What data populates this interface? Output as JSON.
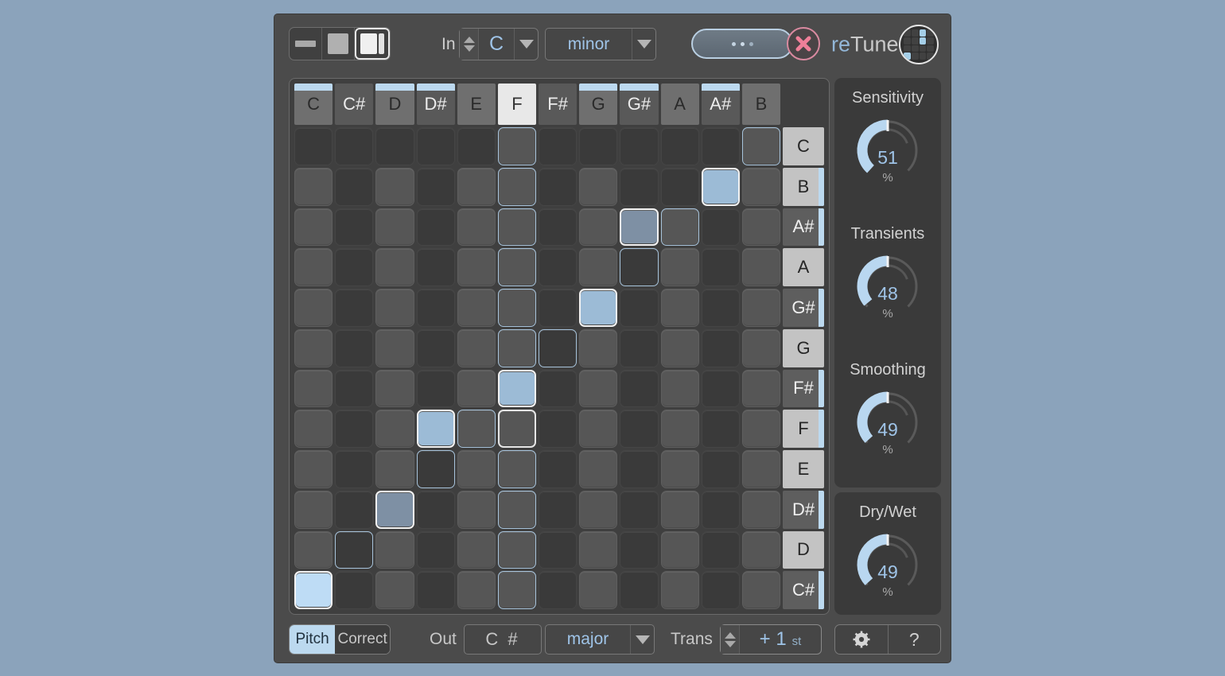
{
  "app": {
    "brand_prefix": "re",
    "brand_suffix": "Tune",
    "logo_icon": "grid-logo-icon"
  },
  "topbar": {
    "view_modes": [
      {
        "name": "view-mode-compact",
        "icon": "bar-icon",
        "selected": false
      },
      {
        "name": "view-mode-square",
        "icon": "square-icon",
        "selected": false
      },
      {
        "name": "view-mode-split",
        "icon": "split-panel-icon",
        "selected": true
      }
    ],
    "in_label": "In",
    "in_key": "C",
    "in_scale": "minor",
    "preset_placeholder": "...",
    "close_icon": "close-x-icon"
  },
  "grid": {
    "columns": [
      "C",
      "C#",
      "D",
      "D#",
      "E",
      "F",
      "F#",
      "G",
      "G#",
      "A",
      "A#",
      "B"
    ],
    "column_black": [
      false,
      true,
      false,
      true,
      false,
      false,
      true,
      false,
      true,
      false,
      true,
      false
    ],
    "column_lit": [
      true,
      false,
      true,
      true,
      false,
      false,
      false,
      true,
      true,
      false,
      true,
      false
    ],
    "column_selected": [
      false,
      false,
      false,
      false,
      false,
      true,
      false,
      false,
      false,
      false,
      false,
      false
    ],
    "rows": [
      "C",
      "B",
      "A#",
      "A",
      "G#",
      "G",
      "F#",
      "F",
      "E",
      "D#",
      "D",
      "C#"
    ],
    "row_black": [
      false,
      false,
      true,
      false,
      true,
      false,
      true,
      false,
      false,
      true,
      false,
      true
    ],
    "row_lit": [
      false,
      true,
      true,
      false,
      true,
      false,
      true,
      true,
      false,
      true,
      false,
      true
    ],
    "cells": [
      [
        "dark",
        "dark",
        "dark",
        "dark",
        "dark",
        "outline",
        "dark",
        "dark",
        "dark",
        "dark",
        "dark",
        "outline"
      ],
      [
        "cell",
        "dark",
        "cell",
        "dark",
        "cell",
        "outline",
        "dark",
        "cell",
        "dark",
        "dark",
        "lit",
        "cell"
      ],
      [
        "cell",
        "dark",
        "cell",
        "dark",
        "cell",
        "outline",
        "dark",
        "cell",
        "litdim",
        "outline",
        "dark",
        "cell"
      ],
      [
        "cell",
        "dark",
        "cell",
        "dark",
        "cell",
        "outline",
        "dark",
        "cell",
        "outlinedark",
        "cell",
        "dark",
        "cell"
      ],
      [
        "cell",
        "dark",
        "cell",
        "dark",
        "cell",
        "outline",
        "dark",
        "lit",
        "dark",
        "cell",
        "dark",
        "cell"
      ],
      [
        "cell",
        "dark",
        "cell",
        "dark",
        "cell",
        "outline",
        "outlinedark",
        "cell",
        "dark",
        "cell",
        "dark",
        "cell"
      ],
      [
        "cell",
        "dark",
        "cell",
        "dark",
        "cell",
        "lit",
        "dark",
        "cell",
        "dark",
        "cell",
        "dark",
        "cell"
      ],
      [
        "cell",
        "dark",
        "cell",
        "lit",
        "outline",
        "outlinew",
        "dark",
        "cell",
        "dark",
        "cell",
        "dark",
        "cell"
      ],
      [
        "cell",
        "dark",
        "cell",
        "outlinedark",
        "cell",
        "outline",
        "dark",
        "cell",
        "dark",
        "cell",
        "dark",
        "cell"
      ],
      [
        "cell",
        "dark",
        "litdim",
        "dark",
        "cell",
        "outline",
        "dark",
        "cell",
        "dark",
        "cell",
        "dark",
        "cell"
      ],
      [
        "cell",
        "outlinedark",
        "cell",
        "dark",
        "cell",
        "outline",
        "dark",
        "cell",
        "dark",
        "cell",
        "dark",
        "cell"
      ],
      [
        "bright",
        "dark",
        "cell",
        "dark",
        "cell",
        "outline",
        "dark",
        "cell",
        "dark",
        "cell",
        "dark",
        "cell"
      ]
    ]
  },
  "knobs": [
    {
      "name": "sensitivity",
      "label": "Sensitivity",
      "value": 51,
      "unit": "%"
    },
    {
      "name": "transients",
      "label": "Transients",
      "value": 48,
      "unit": "%"
    },
    {
      "name": "smoothing",
      "label": "Smoothing",
      "value": 49,
      "unit": "%"
    },
    {
      "name": "drywet",
      "label": "Dry/Wet",
      "value": 49,
      "unit": "%"
    }
  ],
  "bottombar": {
    "toggle_on_label": "Pitch",
    "toggle_off_label": "Correct",
    "out_label": "Out",
    "out_key": "C #",
    "out_scale": "major",
    "trans_label": "Trans",
    "trans_value": "+ 1",
    "trans_unit": "st",
    "settings_icon": "gear-icon",
    "help_icon": "question-mark-icon"
  },
  "colors": {
    "accent_blue": "#9fc4e8",
    "lit_cell": "#9cbbd6",
    "close_pink": "#e8788f",
    "page_bg": "#8ba3bb"
  }
}
